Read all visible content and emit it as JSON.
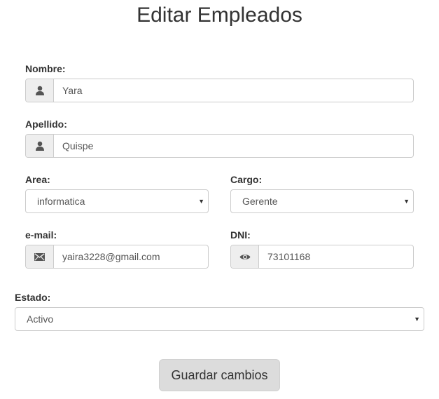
{
  "page": {
    "title": "Editar Empleados"
  },
  "form": {
    "nombre": {
      "label": "Nombre:",
      "value": "Yara",
      "icon": "user-icon"
    },
    "apellido": {
      "label": "Apellido:",
      "value": "Quispe",
      "icon": "user-icon"
    },
    "area": {
      "label": "Area:",
      "selected": "informatica"
    },
    "cargo": {
      "label": "Cargo:",
      "selected": "Gerente"
    },
    "email": {
      "label": "e-mail:",
      "value": "yaira3228@gmail.com",
      "icon": "envelope-icon"
    },
    "dni": {
      "label": "DNI:",
      "value": "73101168",
      "icon": "eye-icon"
    },
    "estado": {
      "label": "Estado:",
      "selected": "Activo"
    },
    "submit_label": "Guardar cambios"
  },
  "colors": {
    "addon_bg": "#eeeeee",
    "border": "#cccccc",
    "button_bg": "#dcdcdc",
    "text": "#333333"
  }
}
